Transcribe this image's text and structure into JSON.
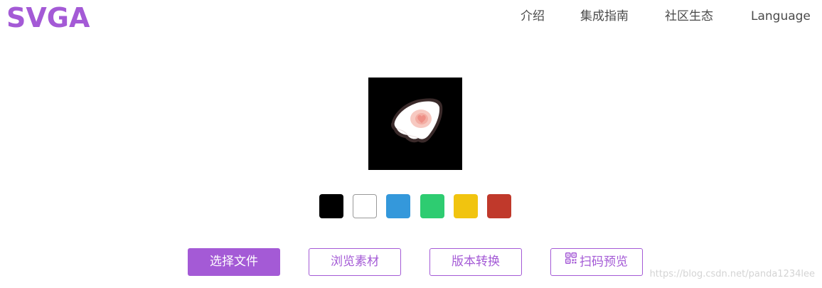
{
  "brand": {
    "logo_text": "SVGA",
    "accent_color": "#a45ad6"
  },
  "nav": {
    "items": [
      {
        "label": "介绍"
      },
      {
        "label": "集成指南"
      },
      {
        "label": "社区生态"
      },
      {
        "label": "Language"
      }
    ]
  },
  "preview": {
    "background": "#000000"
  },
  "swatches": [
    {
      "color": "#000000",
      "name": "black"
    },
    {
      "color": "#ffffff",
      "name": "white"
    },
    {
      "color": "#3498db",
      "name": "blue"
    },
    {
      "color": "#2ecc71",
      "name": "green"
    },
    {
      "color": "#f1c40f",
      "name": "yellow"
    },
    {
      "color": "#c0392b",
      "name": "red"
    }
  ],
  "actions": {
    "select_file": "选择文件",
    "browse_assets": "浏览素材",
    "version_convert": "版本转换",
    "scan_preview": "扫码预览",
    "scan_icon": "qrcode-icon"
  },
  "watermark": "https://blog.csdn.net/panda1234lee"
}
